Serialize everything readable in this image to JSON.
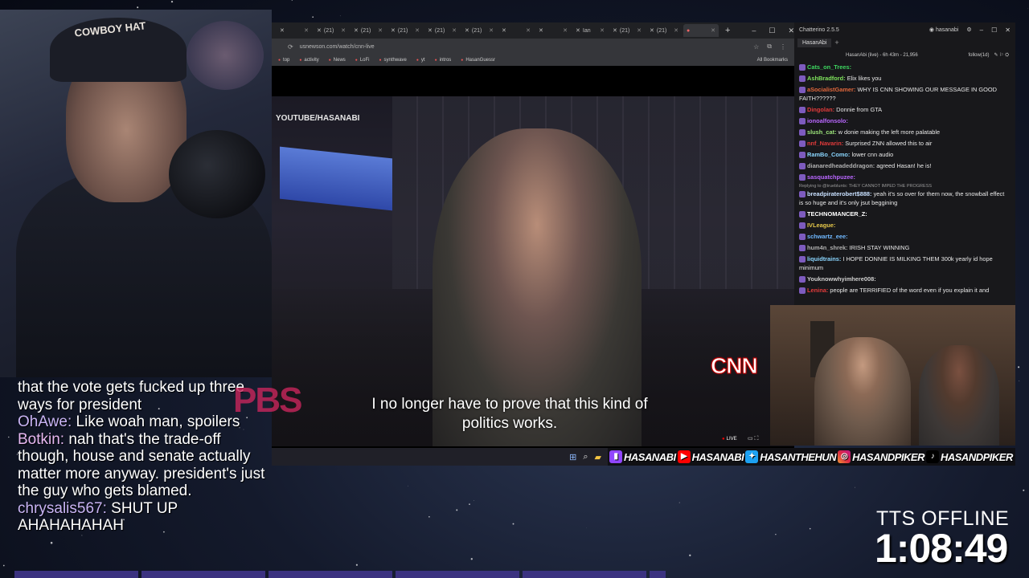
{
  "browser": {
    "tabs": [
      {
        "label": "",
        "active": false
      },
      {
        "label": "(21)",
        "active": false
      },
      {
        "label": "(21)",
        "active": false
      },
      {
        "label": "(21)",
        "active": false
      },
      {
        "label": "(21)",
        "active": false
      },
      {
        "label": "(21)",
        "active": false
      },
      {
        "label": "",
        "active": false
      },
      {
        "label": "",
        "active": false
      },
      {
        "label": "Ian",
        "active": false
      },
      {
        "label": "(21)",
        "active": false
      },
      {
        "label": "(21)",
        "active": false
      },
      {
        "label": "",
        "active": true
      }
    ],
    "url": "usnewson.com/watch/cnn-live",
    "bookmarks": [
      "top",
      "activity",
      "News",
      "LoFi",
      "synthwave",
      "yt",
      "intros",
      "HasanGuessr"
    ],
    "all_bookmarks": "All Bookmarks"
  },
  "video": {
    "watermark": "YOUTUBE/HASANABI",
    "network_logo": "CNN",
    "subtitle": "I no longer have to prove that this kind of politics works.",
    "live": "LIVE"
  },
  "webcam": {
    "cap_text": "COWBOY HAT"
  },
  "chat": {
    "app_title": "Chatterino 2.5.5",
    "user": "hasanabi",
    "tab": "HasanAbi",
    "status": "HasanAbi (live) - 6h 43m - 21,956",
    "follow": "follow(1d)",
    "messages": [
      {
        "user": "Cats_on_Trees:",
        "text": "",
        "color": "#3dd65f"
      },
      {
        "user": "AshBradford:",
        "text": "Elix likes you",
        "color": "#7fe35c"
      },
      {
        "user": "aSocialistGamer:",
        "text": "WHY IS CNN SHOWING OUR MESSAGE IN GOOD FAITH??????",
        "color": "#e0673b"
      },
      {
        "user": "Dingolan:",
        "text": "Donnie from GTA",
        "color": "#e23b3b"
      },
      {
        "user": "ionoalfonsolo:",
        "text": "",
        "color": "#b967ff"
      },
      {
        "user": "slush_cat:",
        "text": "w donie making the left more palatable",
        "color": "#9be37a"
      },
      {
        "user": "nnf_Navarin:",
        "text": "Surprised ZNN allowed this to air",
        "color": "#e23b3b"
      },
      {
        "user": "RamBo_Como:",
        "text": "lower cnn audio",
        "color": "#8ad6ff"
      },
      {
        "user": "dianaredheadeddragon:",
        "text": "agreed Hasan! he is!",
        "color": "#b0b0b0"
      },
      {
        "user": "sasquatchpuzee:",
        "text": "",
        "color": "#b967ff"
      },
      {
        "reply": "Replying to @trueblunts: THEY CANNOT IMPED THE PROGRESS",
        "user": "breadpiraterobert$888:",
        "text": "yeah it's so over for them now, the snowball effect is so huge and it's only jsut beggining",
        "color": "#c8e0ff"
      },
      {
        "user": "TECHNOMANCER_Z:",
        "text": "",
        "color": "#ffffff"
      },
      {
        "user": "IVLeague:",
        "text": "",
        "color": "#e6c84a"
      },
      {
        "user": "schwartz_eee:",
        "text": "",
        "color": "#6fb8ff"
      },
      {
        "user": "hum4n_shrek:",
        "text": "IRISH STAY WINNING",
        "color": "#b0b0b0"
      },
      {
        "user": "liquidtrains:",
        "text": "I HOPE DONNIE IS MILKING THEM 300k yearly id hope minimum",
        "color": "#8ad6ff"
      },
      {
        "user": "Youknowwhyimhere008:",
        "text": "",
        "color": "#d0d0d0"
      },
      {
        "user": "Lenina:",
        "text": "people are TERRIFIED of the word even if you explain it and",
        "color": "#e23b3b"
      }
    ]
  },
  "socials": [
    {
      "icon": "twitch-icon",
      "glyph": "▮",
      "cls": "ic-twitch",
      "label": "HASANABI"
    },
    {
      "icon": "youtube-icon",
      "glyph": "▶",
      "cls": "ic-youtube",
      "label": "HASANABI"
    },
    {
      "icon": "twitter-icon",
      "glyph": "✦",
      "cls": "ic-twitter",
      "label": "HASANTHEHUN"
    },
    {
      "icon": "instagram-icon",
      "glyph": "◎",
      "cls": "ic-instagram",
      "label": "HASANDPIKER"
    },
    {
      "icon": "tiktok-icon",
      "glyph": "♪",
      "cls": "ic-tiktok",
      "label": "HASANDPIKER"
    }
  ],
  "overlay_chat": [
    {
      "user": "",
      "text": "that the vote gets fucked up three ways for president"
    },
    {
      "user": "OhAwe:",
      "text": "Like woah man, spoilers"
    },
    {
      "user": "Botkin:",
      "text": "nah that's the trade-off though, house and senate actually matter more anyway. president's just the guy who gets blamed."
    },
    {
      "user": "chrysalis567:",
      "text": "SHUT UP AHAHAHAHAH"
    }
  ],
  "overlay_logo": "PBS",
  "timer": {
    "tts_status": "TTS OFFLINE",
    "time": "1:08:49"
  }
}
